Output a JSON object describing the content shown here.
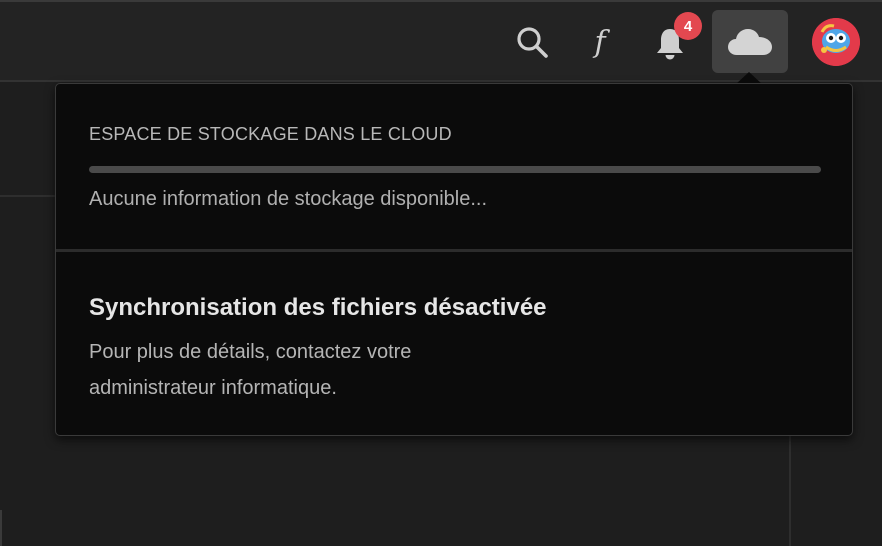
{
  "toolbar": {
    "search_icon": "search-icon",
    "fx_glyph": "f",
    "notifications": {
      "icon": "bell-icon",
      "count": "4",
      "badge_color": "#e34850"
    },
    "cloud_icon": "cloud-icon",
    "avatar_icon": "avatar"
  },
  "cloud_panel": {
    "storage_title": "ESPACE DE STOCKAGE DANS LE CLOUD",
    "storage_progress": 0,
    "storage_status": "Aucune information de stockage disponible...",
    "sync_title": "Synchronisation des fichiers désactivée",
    "sync_description": "Pour plus de détails, contactez votre administrateur informatique."
  },
  "colors": {
    "background": "#1e1e1e",
    "panel": "#0b0b0b",
    "accent_badge": "#e34850"
  }
}
